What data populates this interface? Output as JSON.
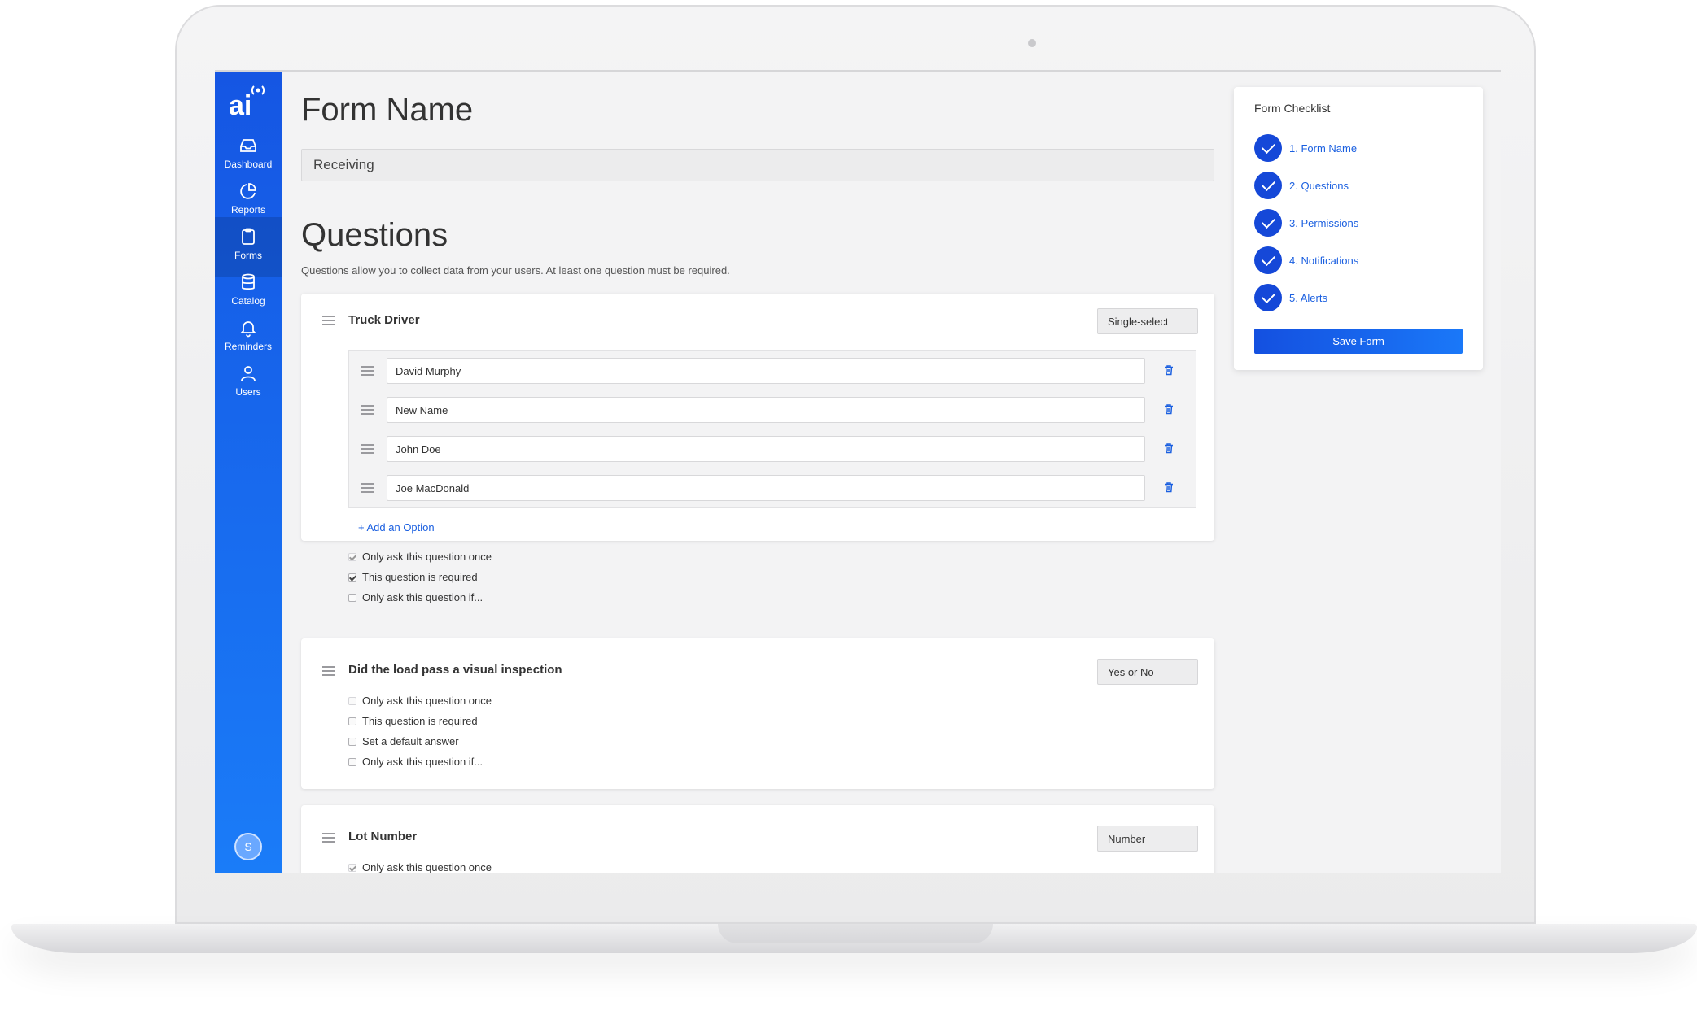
{
  "sidebar": {
    "items": [
      {
        "label": "Dashboard",
        "icon": "inbox-icon"
      },
      {
        "label": "Reports",
        "icon": "pie-chart-icon"
      },
      {
        "label": "Forms",
        "icon": "clipboard-icon",
        "active": true
      },
      {
        "label": "Catalog",
        "icon": "database-icon"
      },
      {
        "label": "Reminders",
        "icon": "bell-icon"
      },
      {
        "label": "Users",
        "icon": "user-icon"
      }
    ],
    "avatar_initial": "S"
  },
  "form": {
    "title": "Form Name",
    "name_value": "Receiving"
  },
  "questions": {
    "title": "Questions",
    "description": "Questions allow you to collect data from your users. At least one question must be required.",
    "items": [
      {
        "title": "Truck Driver",
        "type": "Single-select",
        "options": [
          "David Murphy",
          "New Name",
          "John Doe",
          "Joe MacDonald"
        ],
        "add_option_label": "Add an Option",
        "checks": [
          {
            "label": "Only ask this question once",
            "checked": true
          },
          {
            "label": "This question is required",
            "checked": true
          },
          {
            "label": "Only ask this question if...",
            "checked": false
          }
        ]
      },
      {
        "title": "Did the load pass a visual inspection",
        "type": "Yes or No",
        "checks": [
          {
            "label": "Only ask this question once",
            "checked": false
          },
          {
            "label": "This question is required",
            "checked": false
          },
          {
            "label": "Set a default answer",
            "checked": false
          },
          {
            "label": "Only ask this question if...",
            "checked": false
          }
        ]
      },
      {
        "title": "Lot Number",
        "type": "Number",
        "checks": [
          {
            "label": "Only ask this question once",
            "checked": true
          }
        ]
      }
    ]
  },
  "checklist": {
    "title": "Form Checklist",
    "items": [
      "1. Form Name",
      "2. Questions",
      "3. Permissions",
      "4. Notifications",
      "5. Alerts"
    ],
    "save_label": "Save Form"
  },
  "colors": {
    "brand_blue": "#1556e3",
    "link_blue": "#1a5fe0",
    "check_blue": "#1548d8"
  }
}
